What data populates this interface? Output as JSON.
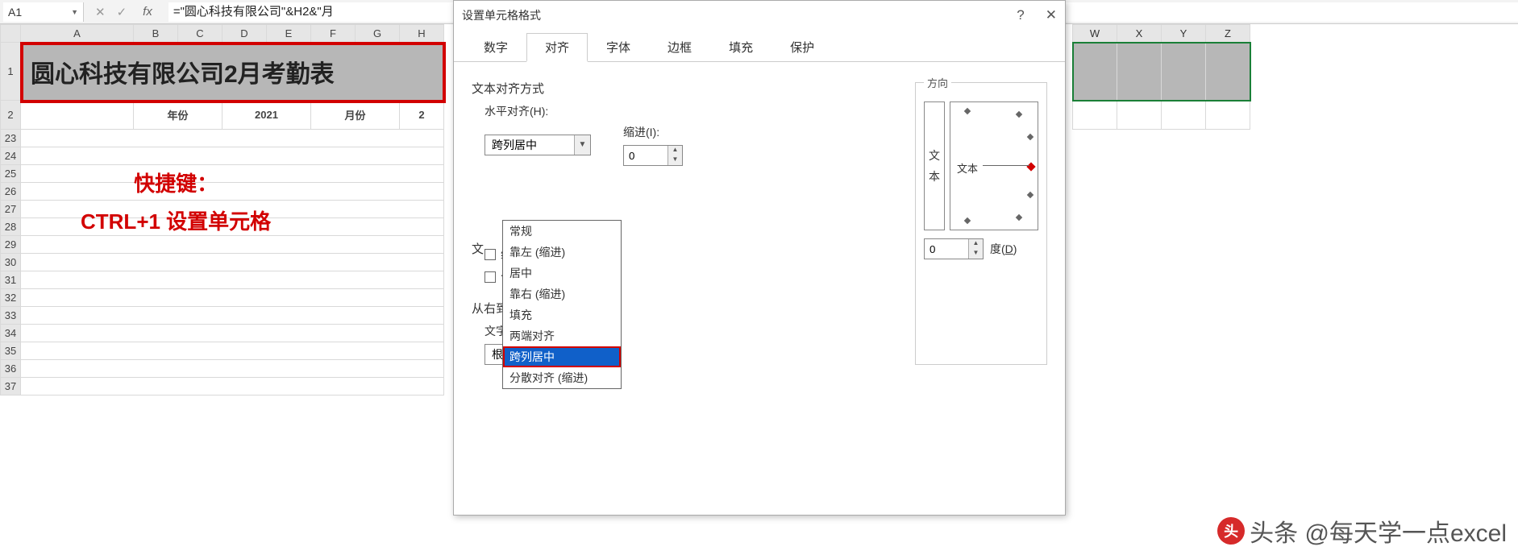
{
  "formula_bar": {
    "cell_ref": "A1",
    "formula": "=\"圆心科技有限公司\"&H2&\"月"
  },
  "columns_left": [
    "A",
    "B",
    "C",
    "D",
    "E",
    "F",
    "G",
    "H"
  ],
  "columns_right": [
    "W",
    "X",
    "Y",
    "Z"
  ],
  "rows": [
    "1",
    "2",
    "23",
    "24",
    "25",
    "26",
    "27",
    "28",
    "29",
    "30",
    "31",
    "32",
    "33",
    "34",
    "35",
    "36",
    "37"
  ],
  "merged_title": "圆心科技有限公司2月考勤表",
  "row2": {
    "b": "年份",
    "d": "2021",
    "f": "月份",
    "h": "2"
  },
  "annotation": {
    "l1": "快捷键：",
    "l2": "CTRL+1 设置单元格"
  },
  "dialog": {
    "title": "设置单元格格式",
    "help": "?",
    "close": "✕",
    "tabs": [
      "数字",
      "对齐",
      "字体",
      "边框",
      "填充",
      "保护"
    ],
    "active_tab": 1,
    "align_section": "文本对齐方式",
    "h_label": "水平对齐(H):",
    "h_value": "跨列居中",
    "indent_label": "缩进(I):",
    "indent_value": "0",
    "v_label_hidden": "文",
    "options": [
      "常规",
      "靠左 (缩进)",
      "居中",
      "靠右 (缩进)",
      "填充",
      "两端对齐",
      "跨列居中",
      "分散对齐 (缩进)"
    ],
    "selected_option": 6,
    "check1": "缩小字体填充(K)",
    "check2": "合并单元格(M)",
    "rtl_section": "从右到左",
    "textdir_label": "文字方向(T):",
    "textdir_value": "根据内容",
    "direction_label": "方向",
    "orient_vert": [
      "文",
      "本"
    ],
    "orient_text": "文本",
    "degree_value": "0",
    "degree_label": "度(D)"
  },
  "watermark": {
    "prefix": "头条 @每天学一点excel",
    "badge": "头"
  }
}
